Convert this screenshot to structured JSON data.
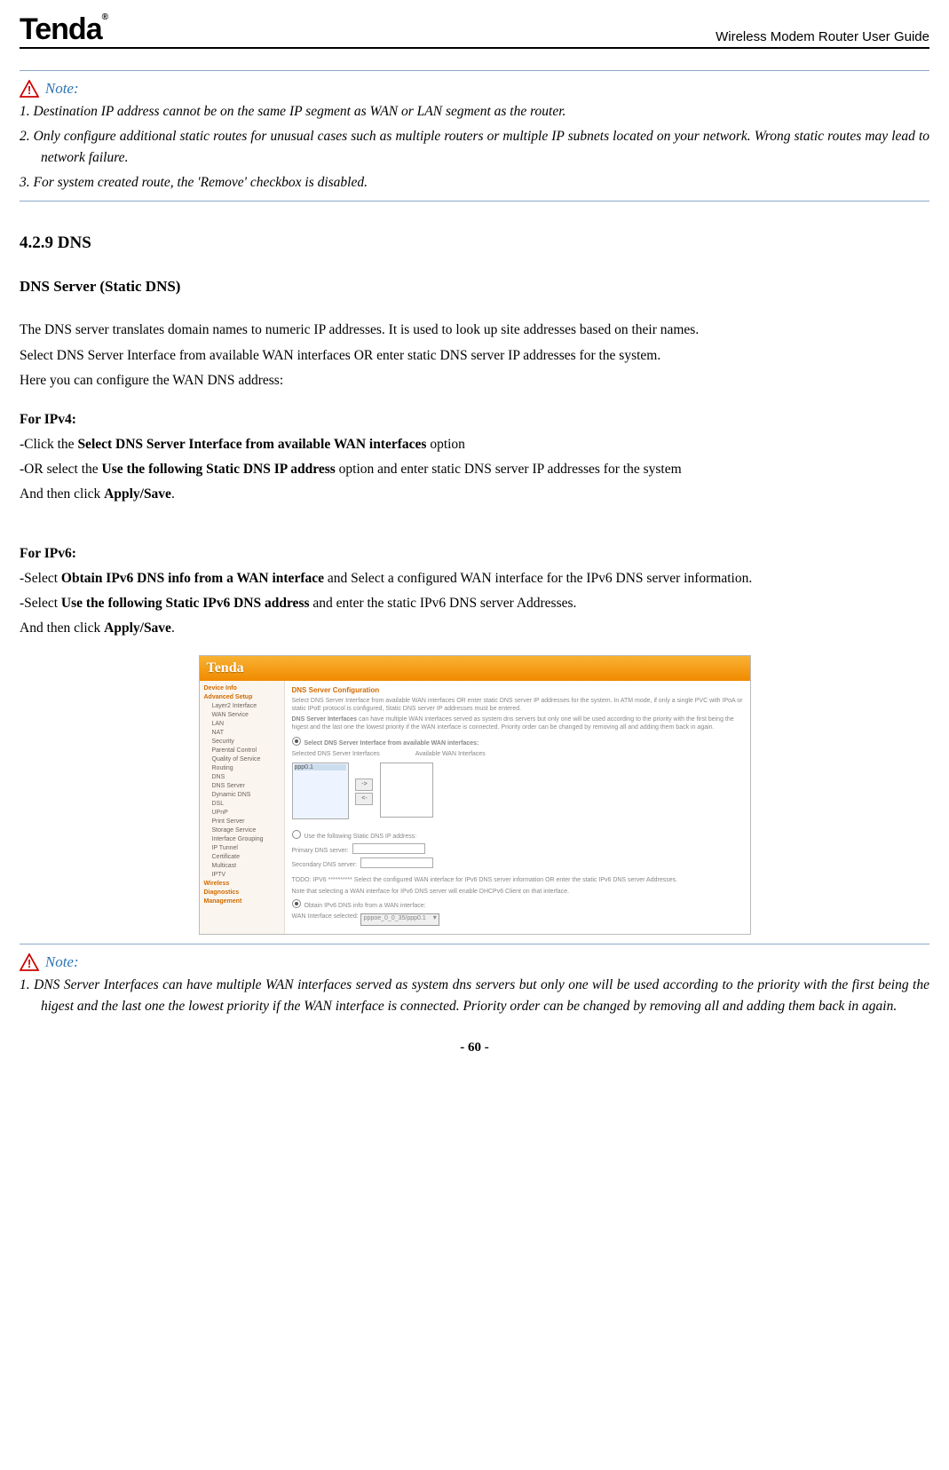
{
  "header": {
    "logo": "Tenda",
    "title": "Wireless Modem Router User Guide"
  },
  "note1": {
    "label": "Note:",
    "items": [
      "1. Destination IP address cannot be on the same IP segment as WAN or LAN segment as the router.",
      "2. Only configure additional static routes for unusual cases such as multiple routers or multiple IP subnets located on your network. Wrong static routes may lead to network failure.",
      "3. For system created route, the 'Remove' checkbox is disabled."
    ]
  },
  "section": {
    "number_title": "4.2.9 DNS",
    "subtitle": "DNS Server (Static DNS)",
    "intro": "The DNS server translates domain names to numeric IP addresses. It is used to look up site addresses based on their names.",
    "line2": "Select DNS Server Interface from available WAN interfaces OR enter static DNS server IP addresses for the system.",
    "line3": "Here you can configure the WAN DNS address:",
    "ipv4_label": "For IPv4:",
    "ipv4_a_pre": "-Click the ",
    "ipv4_a_bold": "Select DNS Server Interface from available WAN interfaces",
    "ipv4_a_post": " option",
    "ipv4_b_pre": "-OR select the ",
    "ipv4_b_bold": "Use the following Static DNS IP address",
    "ipv4_b_post": " option and enter static DNS server IP addresses for the system",
    "ipv4_c_pre": "And then click ",
    "ipv4_c_bold": "Apply/Save",
    "ipv4_c_post": ".",
    "ipv6_label": "For IPv6:",
    "ipv6_a_pre": "-Select ",
    "ipv6_a_bold": "Obtain IPv6 DNS info from a WAN interface",
    "ipv6_a_post": " and Select a configured WAN interface for the IPv6 DNS server information.",
    "ipv6_b_pre": "-Select ",
    "ipv6_b_bold": "Use the following Static IPv6 DNS address",
    "ipv6_b_post": " and enter the static IPv6 DNS server Addresses.",
    "ipv6_c_pre": "And then click ",
    "ipv6_c_bold": "Apply/Save",
    "ipv6_c_post": "."
  },
  "screenshot": {
    "logo": "Tenda",
    "page_title": "DNS Server Configuration",
    "desc1": "Select DNS Server Interface from available WAN interfaces OR enter static DNS server IP addresses for the system. In ATM mode, if only a single PVC with IPoA or static IPoE protocol is configured, Static DNS server IP addresses must be entered.",
    "desc2_pre": "DNS Server Interfaces ",
    "desc2": "can have multiple WAN interfaces served as system dns servers but only one will be used according to the priority with the first being the higest and the last one the lowest priority if the WAN interface is connected. Priority order can be changed by removing all and adding them back in again.",
    "radio1": "Select DNS Server Interface from available WAN interfaces:",
    "col1": "Selected DNS Server Interfaces",
    "col2": "Available WAN Interfaces",
    "list_item": "ppp0.1",
    "radio2": "Use the following Static DNS IP address:",
    "primary": "Primary DNS server:",
    "secondary": "Secondary DNS server:",
    "ipv6_hint": "TODO: IPV6 ********** Select the configured WAN interface for IPv6 DNS server information OR enter the static IPv6 DNS server Addresses.",
    "ipv6_hint2": "Note that selecting a WAN interface for IPv6 DNS server will enable DHCPv6 Client on that interface.",
    "radio3": "Obtain IPv6 DNS info from a WAN interface:",
    "wan_sel_label": "WAN Interface selected:",
    "wan_sel_value": "pppoe_0_0_35/ppp0.1",
    "sidebar": {
      "items": [
        {
          "t": "Device Info",
          "c": "l0"
        },
        {
          "t": "Advanced Setup",
          "c": "l0"
        },
        {
          "t": "Layer2 Interface",
          "c": "l1"
        },
        {
          "t": "WAN Service",
          "c": "l1"
        },
        {
          "t": "LAN",
          "c": "l1"
        },
        {
          "t": "NAT",
          "c": "l1"
        },
        {
          "t": "Security",
          "c": "l1"
        },
        {
          "t": "Parental Control",
          "c": "l1"
        },
        {
          "t": "Quality of Service",
          "c": "l1"
        },
        {
          "t": "Routing",
          "c": "l1"
        },
        {
          "t": "DNS",
          "c": "l1"
        },
        {
          "t": "DNS Server",
          "c": "l1"
        },
        {
          "t": "Dynamic DNS",
          "c": "l1"
        },
        {
          "t": "DSL",
          "c": "l1"
        },
        {
          "t": "UPnP",
          "c": "l1"
        },
        {
          "t": "Print Server",
          "c": "l1"
        },
        {
          "t": "Storage Service",
          "c": "l1"
        },
        {
          "t": "Interface Grouping",
          "c": "l1"
        },
        {
          "t": "IP Tunnel",
          "c": "l1"
        },
        {
          "t": "Certificate",
          "c": "l1"
        },
        {
          "t": "Multicast",
          "c": "l1"
        },
        {
          "t": "IPTV",
          "c": "l1"
        },
        {
          "t": "Wireless",
          "c": "l0"
        },
        {
          "t": "Diagnostics",
          "c": "l0"
        },
        {
          "t": "Management",
          "c": "l0"
        }
      ]
    }
  },
  "note2": {
    "label": "Note:",
    "text": "1. DNS Server Interfaces can have multiple WAN interfaces served as system dns servers but only one will be used according to the priority with the first being the higest and the last one the lowest priority if the WAN interface is connected. Priority order can be changed by removing all and adding them back in again."
  },
  "footer": "- 60 -"
}
